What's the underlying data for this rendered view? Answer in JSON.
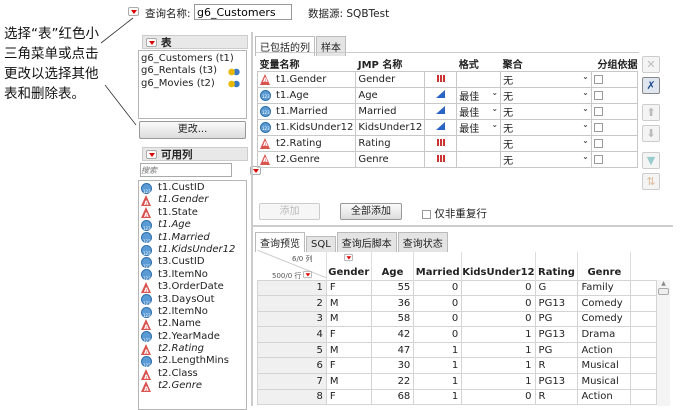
{
  "header": {
    "query_label": "查询名称:",
    "query_name": "g6_Customers",
    "source_label": "数据源:",
    "source_value": "SQBTest"
  },
  "callout": "选择“表”红色小三角菜单或点击更改以选择其他表和删除表。",
  "tables_panel": {
    "title": "表",
    "items": [
      {
        "label": "g6_Customers (t1)",
        "join": false
      },
      {
        "label": "g6_Rentals (t3)",
        "join": true
      },
      {
        "label": "g6_Movies (t2)",
        "join": true
      }
    ],
    "change_button": "更改..."
  },
  "available_panel": {
    "title": "可用列",
    "search_placeholder": "搜索",
    "items": [
      {
        "label": "t1.CustID",
        "type": "numeric",
        "included": false
      },
      {
        "label": "t1.Gender",
        "type": "character",
        "included": true
      },
      {
        "label": "t1.State",
        "type": "character",
        "included": false
      },
      {
        "label": "t1.Age",
        "type": "numeric",
        "included": true
      },
      {
        "label": "t1.Married",
        "type": "numeric",
        "included": true
      },
      {
        "label": "t1.KidsUnder12",
        "type": "numeric",
        "included": true
      },
      {
        "label": "t3.CustID",
        "type": "numeric",
        "included": false
      },
      {
        "label": "t3.ItemNo",
        "type": "numeric",
        "included": false
      },
      {
        "label": "t3.OrderDate",
        "type": "character",
        "included": false
      },
      {
        "label": "t3.DaysOut",
        "type": "numeric",
        "included": false
      },
      {
        "label": "t2.ItemNo",
        "type": "numeric",
        "included": false
      },
      {
        "label": "t2.Name",
        "type": "character",
        "included": false
      },
      {
        "label": "t2.YearMade",
        "type": "numeric",
        "included": false
      },
      {
        "label": "t2.Rating",
        "type": "character",
        "included": true
      },
      {
        "label": "t2.LengthMins",
        "type": "numeric",
        "included": false
      },
      {
        "label": "t2.Class",
        "type": "character",
        "included": false
      },
      {
        "label": "t2.Genre",
        "type": "character",
        "included": true
      }
    ]
  },
  "included": {
    "tabs": [
      "已包括的列",
      "样本"
    ],
    "headers": [
      "变量名称",
      "JMP 名称",
      "",
      "格式",
      "聚合",
      "分组依据"
    ],
    "rows": [
      {
        "type": "character",
        "name": "t1.Gender",
        "jmp": "Gender",
        "modeling": "nominal",
        "format": "",
        "agg": "无"
      },
      {
        "type": "numeric",
        "name": "t1.Age",
        "jmp": "Age",
        "modeling": "continuous",
        "format": "最佳",
        "agg": "无"
      },
      {
        "type": "numeric",
        "name": "t1.Married",
        "jmp": "Married",
        "modeling": "continuous",
        "format": "最佳",
        "agg": "无"
      },
      {
        "type": "numeric",
        "name": "t1.KidsUnder12",
        "jmp": "KidsUnder12",
        "modeling": "continuous",
        "format": "最佳",
        "agg": "无"
      },
      {
        "type": "character",
        "name": "t2.Rating",
        "jmp": "Rating",
        "modeling": "nominal",
        "format": "",
        "agg": "无"
      },
      {
        "type": "character",
        "name": "t2.Genre",
        "jmp": "Genre",
        "modeling": "nominal",
        "format": "",
        "agg": "无"
      }
    ],
    "add_button": "添加",
    "add_all_button": "全部添加",
    "distinct_label": "仅非重复行"
  },
  "preview": {
    "tabs": [
      "查询预览",
      "SQL",
      "查询后脚本",
      "查询状态"
    ],
    "cols_info": "6/0 列",
    "rows_info": "500/0 行",
    "columns": [
      "Gender",
      "Age",
      "Married",
      "KidsUnder12",
      "Rating",
      "Genre"
    ],
    "rows": [
      [
        "1",
        "F",
        "55",
        "0",
        "0",
        "G",
        "Family"
      ],
      [
        "2",
        "M",
        "36",
        "0",
        "0",
        "PG13",
        "Comedy"
      ],
      [
        "3",
        "M",
        "58",
        "0",
        "0",
        "PG",
        "Comedy"
      ],
      [
        "4",
        "F",
        "42",
        "0",
        "1",
        "PG13",
        "Drama"
      ],
      [
        "5",
        "M",
        "47",
        "1",
        "1",
        "PG",
        "Action"
      ],
      [
        "6",
        "F",
        "30",
        "1",
        "1",
        "R",
        "Musical"
      ],
      [
        "7",
        "M",
        "22",
        "1",
        "1",
        "PG13",
        "Musical"
      ],
      [
        "8",
        "F",
        "68",
        "1",
        "0",
        "R",
        "Action"
      ]
    ]
  }
}
